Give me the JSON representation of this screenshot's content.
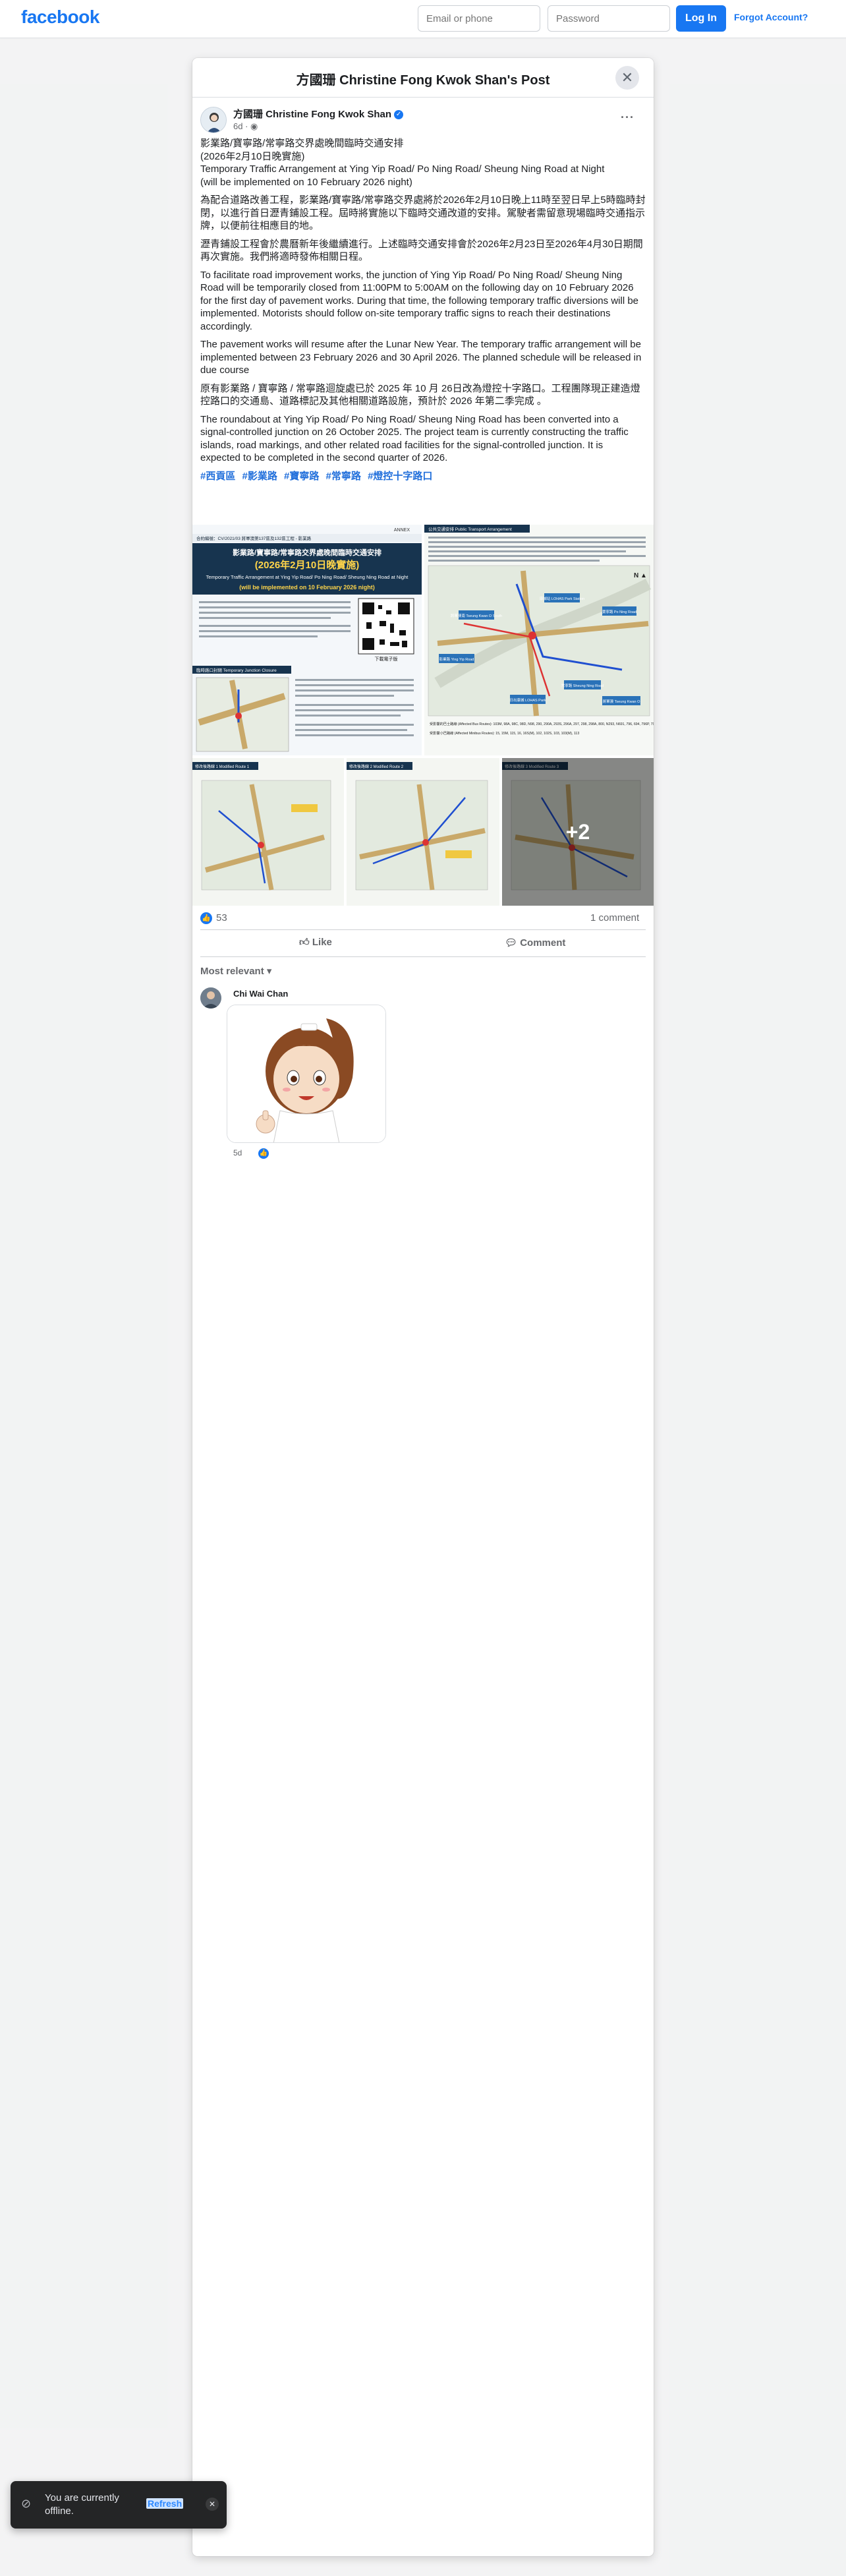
{
  "topbar": {
    "logo": "facebook",
    "email_placeholder": "Email or phone",
    "password_placeholder": "Password",
    "login_label": "Log In",
    "forgot_label": "Forgot Account?"
  },
  "modal": {
    "title": "方國珊 Christine Fong Kwok Shan's Post",
    "close_icon": "close-icon"
  },
  "post": {
    "author": "方國珊 Christine Fong Kwok Shan",
    "time": "6d",
    "privacy_icon": "globe-icon",
    "paragraphs": [
      "影業路/寶寧路/常寧路交界處晚間臨時交通安排\n(2026年2月10日晚實施)\nTemporary Traffic Arrangement at Ying Yip Road/ Po Ning Road/ Sheung Ning Road at Night\n(will be implemented on 10 February 2026 night)",
      "為配合道路改善工程，影業路/寶寧路/常寧路交界處將於2026年2月10日晚上11時至翌日早上5時臨時封閉，以進行首日瀝青鋪設工程。屆時將實施以下臨時交通改道的安排。駕駛者需留意現場臨時交通指示牌，以便前往相應目的地。",
      "瀝青鋪設工程會於農曆新年後繼續進行。上述臨時交通安排會於2026年2月23日至2026年4月30日期間再次實施。我們將適時發佈相關日程。",
      "To facilitate road improvement works, the junction of Ying Yip Road/ Po Ning Road/ Sheung Ning Road will be temporarily closed from 11:00PM to 5:00AM on the following day on 10 February 2026 for the first day of pavement works. During that time, the following temporary traffic diversions will be implemented. Motorists should follow on-site temporary traffic signs to reach their destinations\naccordingly.",
      "The pavement works will resume after the Lunar New Year. The temporary traffic arrangement will be implemented between 23 February 2026 and 30 April 2026. The planned schedule will be released in due course",
      "原有影業路 / 寶寧路 / 常寧路迴旋處已於 2025 年 10 月 26日改為燈控十字路口。工程團隊現正建造燈控路口的交通島、道路標記及其他相關道路設施，預計於 2026 年第二季完成 。",
      "The roundabout at Ying Yip Road/ Po Ning Road/ Sheung Ning Road has been converted into a signal-controlled junction on 26 October 2025. The project team is currently constructing the traffic islands, road markings, and other related road facilities for the signal-controlled junction. It is expected to be completed in the second quarter of 2026."
    ],
    "hashtags": [
      "#西貢區",
      "#影業路",
      "#寶寧路",
      "#常寧路",
      "#燈控十字路口"
    ],
    "more_images_label": "+2",
    "reaction_count": "53",
    "comment_count": "1 comment",
    "like_label": "Like",
    "comment_label": "Comment",
    "sort_label": "Most relevant"
  },
  "images": {
    "poster": {
      "tag": "ANNEX",
      "contract": "合約編號：CV/2021/03 將軍澳第137區及132區工程 - 影業路",
      "title_zh": "影業路/寶寧路/常寧路交界處晚間臨時交通安排",
      "title_en": "Temporary Traffic Arrangement at Ying Yip Road/ Po Ning Road/ Sheung Ning Road at Night",
      "date_zh": "(2026年2月10日晚實施)",
      "date_en": "(will be implemented on 10 February 2026 night)",
      "qr_label": "下載電子版",
      "section": "臨時路口封閉 Temporary Junction Closure"
    },
    "map": {
      "section": "公共交通安排 Public Transport Arrangement",
      "labels": [
        "將軍澳南 Tseung Kwan O South",
        "康城站 LOHAS Park Station",
        "寶寧路 Po Ning Road",
        "影業路 Ying Yip Road",
        "常寧路 Sheung Ning Road",
        "日出康城 LOHAS Park",
        "將軍澳 Tseung Kwan O"
      ],
      "footer_zh": "受影響的巴士路線 (Affected Bus Routes): 103M, 98A, 98C, 98D, N98, 290, 290A, 293S, 296A, 297, 298, 298A, 800, N293, N691, 796, 694, 796P, 796X, 798, A29, E22A, N29, NA29, NA29",
      "footer_zh2": "受影響小巴路線 (Affected Minibus Routes): 15, 15M, 115, 16, 16S(M), 102, 102S, 103, 103(M), 113"
    },
    "small": [
      {
        "label": "修改後路線 1 Modified Route 1"
      },
      {
        "label": "修改後路線 2 Modified Route 2"
      },
      {
        "label": "修改後路線 3 Modified Route 3"
      }
    ]
  },
  "comment": {
    "author": "Chi Wai Chan",
    "time": "5d"
  },
  "toast": {
    "text": "You are currently offline.",
    "refresh_label": "Refresh",
    "icon": "wifi-off-icon"
  }
}
